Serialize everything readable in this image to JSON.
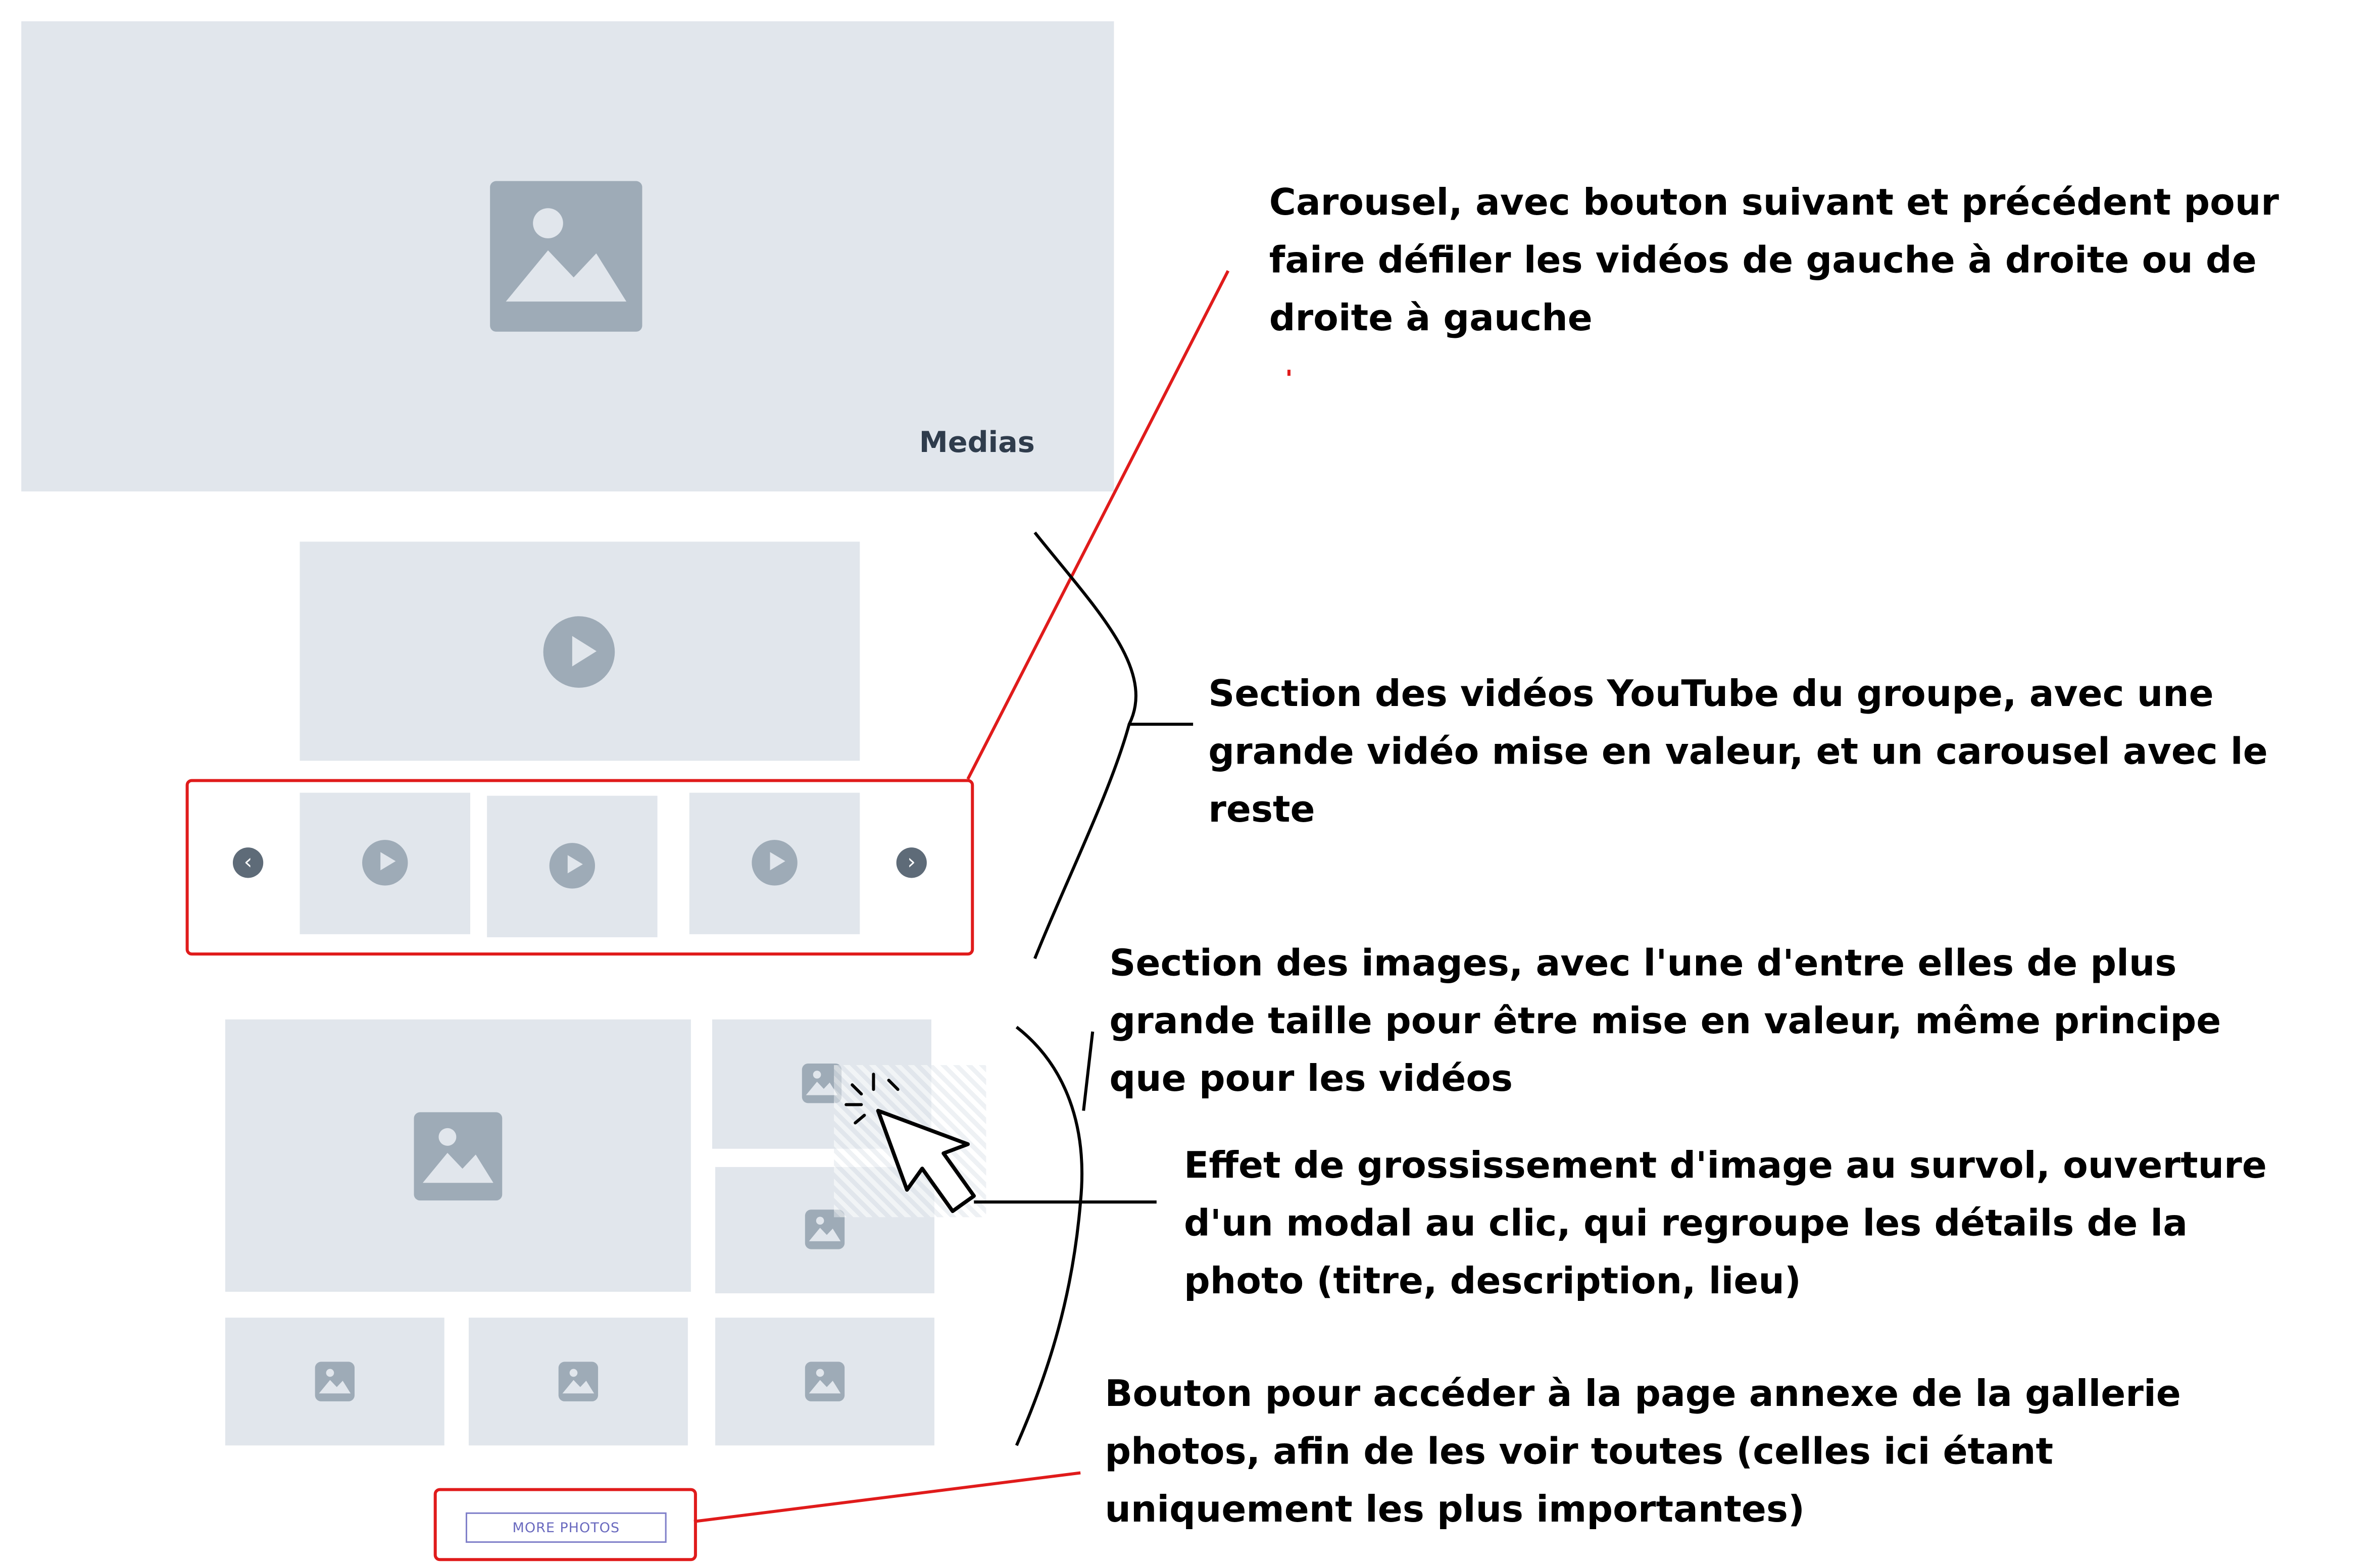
{
  "hero": {
    "title": "Medias"
  },
  "gallery": {
    "more_button": "MORE PHOTOS"
  },
  "carousel": {
    "prev_glyph": "‹",
    "next_glyph": "›"
  },
  "annotations": {
    "carousel": [
      "Carousel, avec bouton suivant et précédent pour",
      "faire défiler les vidéos de gauche à droite ou de",
      "droite à gauche"
    ],
    "videos": [
      "Section des vidéos YouTube du groupe, avec une",
      "grande vidéo mise en valeur, et un carousel avec le",
      "reste"
    ],
    "images": [
      "Section des images, avec l'une d'entre elles de plus",
      "grande taille pour être mise en valeur, même principe",
      "que pour les vidéos"
    ],
    "hover": [
      "Effet de grossissement d'image au survol, ouverture",
      "d'un modal au clic, qui regroupe les détails de la",
      "photo (titre, description, lieu)"
    ],
    "button": [
      "Bouton pour accéder à la page annexe de la gallerie",
      "photos, afin de les voir toutes (celles ici étant",
      "uniquement les plus importantes)"
    ]
  },
  "colors": {
    "placeholder": "#e1e6ec",
    "icon": "#9eabb7",
    "highlight": "#e01b1b",
    "ink": "#000000"
  }
}
